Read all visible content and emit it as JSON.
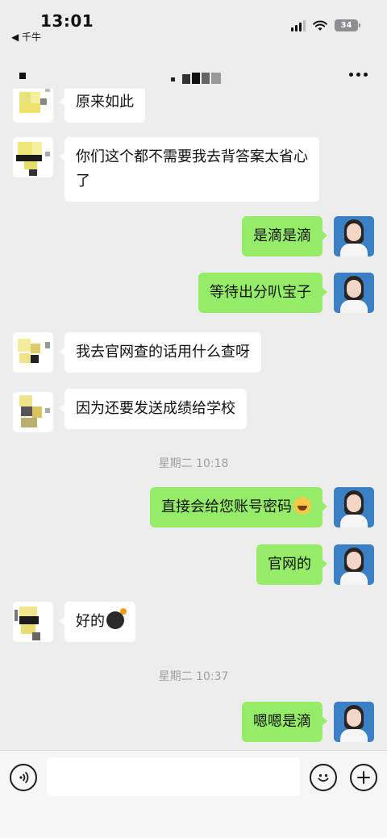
{
  "status_bar": {
    "time": "13:01",
    "back_app": "◀ 千牛",
    "battery": "34"
  },
  "colors": {
    "background": "#ededed",
    "self_bubble": "#95ec69",
    "peer_bubble": "#ffffff",
    "timestamp": "#a0a0a0"
  },
  "icons": {
    "more": "more-icon",
    "voice": "voice-icon",
    "emoji": "emoji-icon",
    "plus": "plus-icon"
  },
  "messages": [
    {
      "sender": "peer",
      "text": "原来如此"
    },
    {
      "sender": "peer",
      "text": "你们这个都不需要我去背答案太省心了"
    },
    {
      "sender": "self",
      "text": "是滴是滴"
    },
    {
      "sender": "self",
      "text": "等待出分叭宝子"
    },
    {
      "sender": "peer",
      "text": "我去官网查的话用什么查呀"
    },
    {
      "sender": "peer",
      "text": "因为还要发送成绩给学校"
    },
    {
      "type": "timestamp",
      "text": "星期二 10:18"
    },
    {
      "sender": "self",
      "text": "直接会给您账号密码",
      "emoji": "laughing-tears"
    },
    {
      "sender": "self",
      "text": "官网的"
    },
    {
      "sender": "peer",
      "text": "好的",
      "emoji": "bomb"
    },
    {
      "type": "timestamp",
      "text": "星期二 10:37"
    },
    {
      "sender": "self",
      "text": "嗯嗯是滴"
    }
  ],
  "input": {
    "value": "",
    "placeholder": ""
  }
}
